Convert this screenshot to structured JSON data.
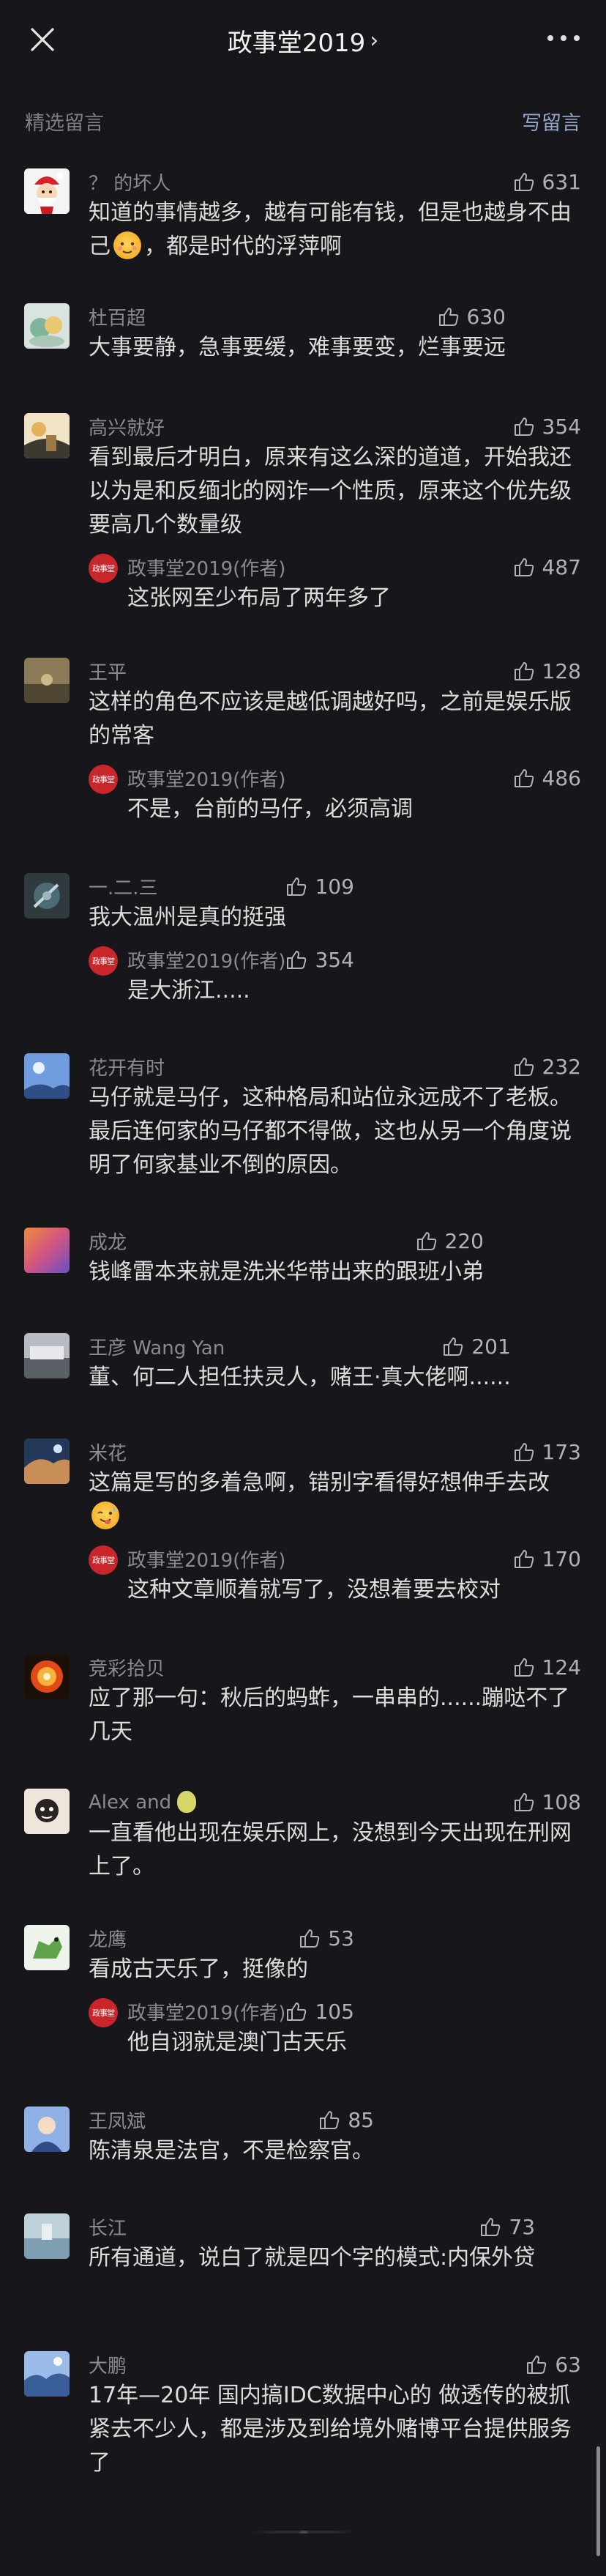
{
  "header": {
    "title": "政事堂2019",
    "chevron": "›"
  },
  "section": {
    "label": "精选留言",
    "write": "写留言"
  },
  "comments": [
    {
      "nick": "？ 的坏人",
      "likes": "631",
      "text_a": "知道的事情越多，越有可能有钱，但是也越身不由己",
      "text_b": "，都是时代的浮萍啊",
      "avatar_color": "#f4f4f4",
      "reply": null
    },
    {
      "nick": "杜百超",
      "likes": "630",
      "text_a": "大事要静，急事要缓，难事要变，烂事要远",
      "avatar_color": "#9bb9a8",
      "reply": null
    },
    {
      "nick": "高兴就好",
      "likes": "354",
      "text_a": "看到最后才明白，原来有这么深的道道，开始我还以为是和反缅北的网诈一个性质，原来这个优先级要高几个数量级",
      "avatar_color": "#c9a46b",
      "reply": {
        "nick": "政事堂2019(作者)",
        "likes": "487",
        "text": "这张网至少布局了两年多了"
      }
    },
    {
      "nick": "王平",
      "likes": "128",
      "text_a": "这样的角色不应该是越低调越好吗，之前是娱乐版的常客",
      "avatar_color": "#6a5a3f",
      "reply": {
        "nick": "政事堂2019(作者)",
        "likes": "486",
        "text": "不是，台前的马仔，必须高调"
      }
    },
    {
      "nick": "一.二.三",
      "likes": "109",
      "text_a": "我大温州是真的挺强",
      "avatar_color": "#4d6b74",
      "reply": {
        "nick": "政事堂2019(作者)",
        "likes": "354",
        "text": "是大浙江....."
      }
    },
    {
      "nick": "花开有时",
      "likes": "232",
      "text_a": "马仔就是马仔，这种格局和站位永远成不了老板。最后连何家的马仔都不得做，这也从另一个角度说明了何家基业不倒的原因。",
      "avatar_color": "#5f86c4",
      "reply": null
    },
    {
      "nick": "成龙",
      "likes": "220",
      "text_a": "钱峰雷本来就是洗米华带出来的跟班小弟",
      "avatar_color": "#d2557f",
      "reply": null
    },
    {
      "nick": "王彦 Wang Yan",
      "likes": "201",
      "text_a": "董、何二人担任扶灵人，赌王·真大佬啊......",
      "avatar_color": "#8c8f95",
      "reply": null
    },
    {
      "nick": "米花",
      "likes": "173",
      "text_a": "这篇是写的多着急啊，错别字看得好想伸手去改",
      "avatar_color": "#3f5e88",
      "reply": {
        "nick": "政事堂2019(作者)",
        "likes": "170",
        "text": "这种文章顺着就写了，没想着要去校对"
      }
    },
    {
      "nick": "竞彩拾贝",
      "likes": "124",
      "text_a": "应了那一句：秋后的蚂蚱，一串串的......蹦哒不了几天",
      "avatar_color": "#c53a1e",
      "reply": null
    },
    {
      "nick": "Alex and",
      "likes": "108",
      "text_a": "一直看他出现在娱乐网上，没想到今天出现在刑网上了。",
      "avatar_color": "#e9e4d6",
      "reply": null
    },
    {
      "nick": "龙鹰",
      "likes": "53",
      "text_a": "看成古天乐了，挺像的",
      "avatar_color": "#5fa34a",
      "reply": {
        "nick": "政事堂2019(作者)",
        "likes": "105",
        "text": "他自诩就是澳门古天乐"
      }
    },
    {
      "nick": "王凤斌",
      "likes": "85",
      "text_a": "陈清泉是法官，不是检察官。",
      "avatar_color": "#4f6fa8",
      "reply": null
    },
    {
      "nick": "长江",
      "likes": "73",
      "text_a": "所有通道，说白了就是四个字的模式:内保外贷",
      "avatar_color": "#7d9fb1",
      "reply": null
    },
    {
      "nick": "大鹏",
      "likes": "63",
      "text_a": "17年—20年 国内搞IDC数据中心的 做透传的被抓紧去不少人，都是涉及到给境外赌博平台提供服务了",
      "avatar_color": "#5e7fb3",
      "reply": null
    }
  ],
  "author_badge_text": "政事堂",
  "colors": {
    "background": "#17161b",
    "accent_link": "#93a6c8",
    "author_badge": "#c9262c"
  }
}
